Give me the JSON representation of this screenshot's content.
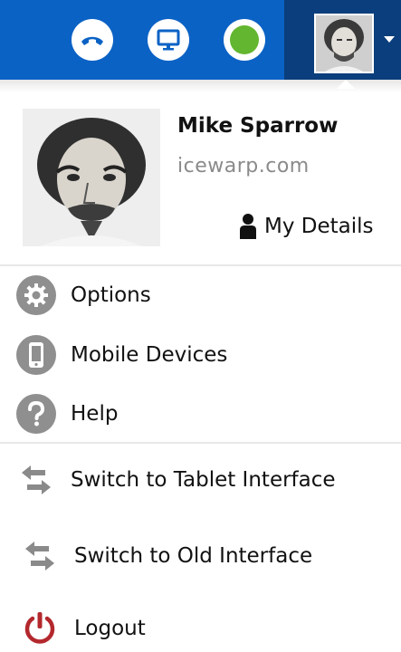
{
  "topbar": {
    "icons": [
      {
        "name": "phone-icon"
      },
      {
        "name": "monitor-icon"
      },
      {
        "name": "status-online-icon",
        "color": "#63b62f"
      }
    ],
    "accent": "#0b62c5",
    "user_segment_color": "#0a3e7c"
  },
  "profile": {
    "name": "Mike Sparrow",
    "domain": "icewarp.com",
    "details_label": "My Details",
    "details_icon": "person-icon"
  },
  "menu": {
    "section1": [
      {
        "label": "Options",
        "icon": "gear-icon"
      },
      {
        "label": "Mobile Devices",
        "icon": "mobile-phone-icon"
      },
      {
        "label": "Help",
        "icon": "question-icon"
      }
    ],
    "section2": [
      {
        "label": "Switch to Tablet Interface",
        "icon": "swap-arrows-icon"
      },
      {
        "label": "Switch to Old Interface",
        "icon": "swap-arrows-icon"
      },
      {
        "label": "Logout",
        "icon": "power-icon",
        "color": "#b3282d"
      }
    ]
  }
}
